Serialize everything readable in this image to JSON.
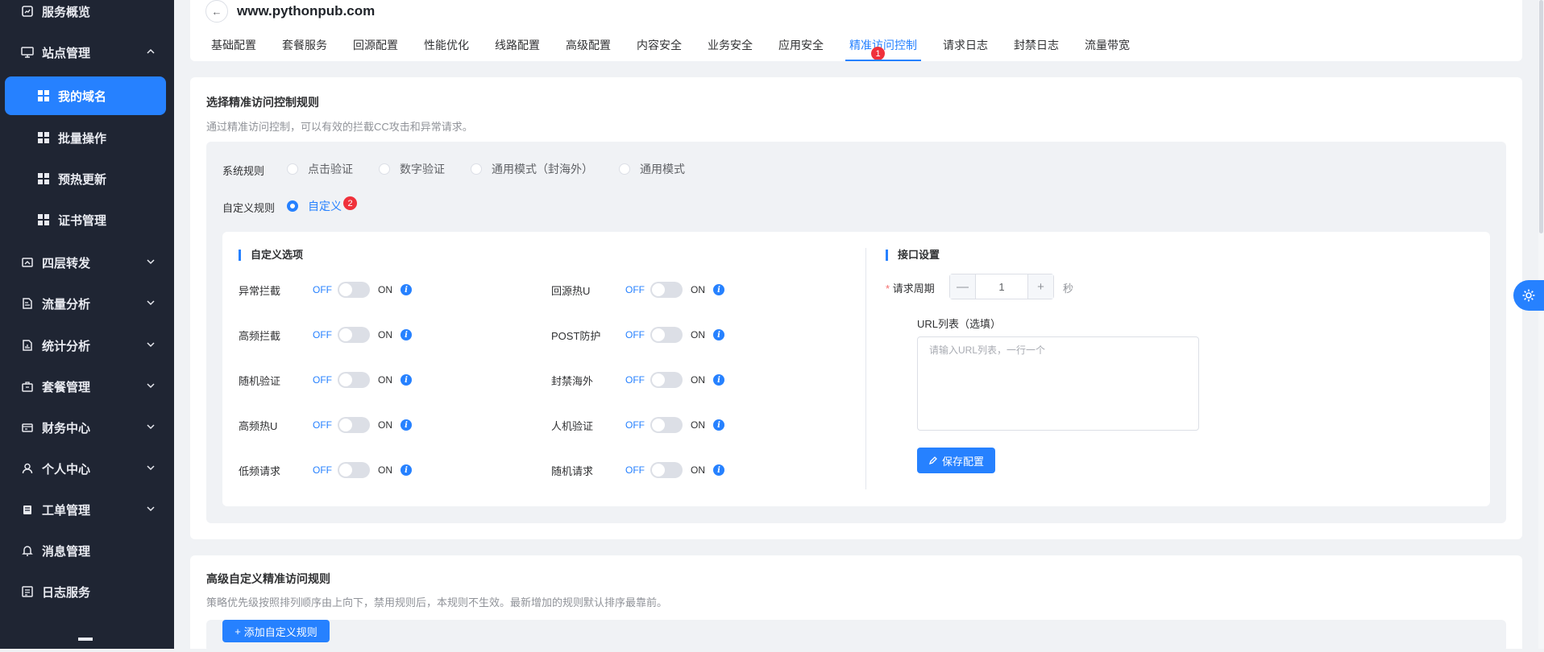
{
  "sidebar": {
    "items": [
      {
        "label": "服务概览",
        "icon": "chart-icon"
      },
      {
        "label": "站点管理",
        "icon": "monitor-icon"
      },
      {
        "label": "我的域名",
        "icon": "grid-icon"
      },
      {
        "label": "批量操作",
        "icon": "grid-icon"
      },
      {
        "label": "预热更新",
        "icon": "grid-icon"
      },
      {
        "label": "证书管理",
        "icon": "grid-icon"
      },
      {
        "label": "四层转发",
        "icon": "forward-icon"
      },
      {
        "label": "流量分析",
        "icon": "analysis-icon"
      },
      {
        "label": "统计分析",
        "icon": "stats-icon"
      },
      {
        "label": "套餐管理",
        "icon": "package-icon"
      },
      {
        "label": "财务中心",
        "icon": "finance-icon"
      },
      {
        "label": "个人中心",
        "icon": "user-icon"
      },
      {
        "label": "工单管理",
        "icon": "ticket-icon"
      },
      {
        "label": "消息管理",
        "icon": "bell-icon"
      },
      {
        "label": "日志服务",
        "icon": "log-icon"
      }
    ]
  },
  "header": {
    "domain": "www.pythonpub.com",
    "tabs": [
      "基础配置",
      "套餐服务",
      "回源配置",
      "性能优化",
      "线路配置",
      "高级配置",
      "内容安全",
      "业务安全",
      "应用安全",
      "精准访问控制",
      "请求日志",
      "封禁日志",
      "流量带宽"
    ],
    "active_tab": "精准访问控制",
    "tab_badge": "1"
  },
  "rules_card": {
    "title": "选择精准访问控制规则",
    "desc": "通过精准访问控制，可以有效的拦截CC攻击和异常请求。",
    "system_label": "系统规则",
    "system_options": [
      "点击验证",
      "数字验证",
      "通用模式（封海外）",
      "通用模式"
    ],
    "custom_label": "自定义规则",
    "custom_option": "自定义",
    "custom_badge": "2",
    "custom_section": {
      "title": "自定义选项",
      "off": "OFF",
      "on": "ON",
      "left": [
        {
          "name": "异常拦截",
          "enabled": false
        },
        {
          "name": "高频拦截",
          "enabled": false
        },
        {
          "name": "随机验证",
          "enabled": false
        },
        {
          "name": "高频热U",
          "enabled": false
        },
        {
          "name": "低频请求",
          "enabled": false
        }
      ],
      "right": [
        {
          "name": "回源热U",
          "enabled": false
        },
        {
          "name": "POST防护",
          "enabled": false
        },
        {
          "name": "封禁海外",
          "enabled": false
        },
        {
          "name": "人机验证",
          "enabled": false
        },
        {
          "name": "随机请求",
          "enabled": false
        }
      ]
    },
    "interface": {
      "title": "接口设置",
      "star": "*",
      "period_label": "请求周期",
      "minus": "—",
      "period_value": "1",
      "plus": "+",
      "unit": "秒",
      "url_label": "URL列表（选填）",
      "url_placeholder": "请输入URL列表，一行一个",
      "save_label": "保存配置"
    }
  },
  "advanced_card": {
    "title": "高级自定义精准访问规则",
    "desc": "策略优先级按照排列顺序由上向下，禁用规则后，本规则不生效。最新增加的规则默认排序最靠前。",
    "add_label": "添加自定义规则"
  },
  "colors": {
    "primary": "#2681ff",
    "sidebar_bg": "#1f2533",
    "badge": "#f0313b"
  }
}
